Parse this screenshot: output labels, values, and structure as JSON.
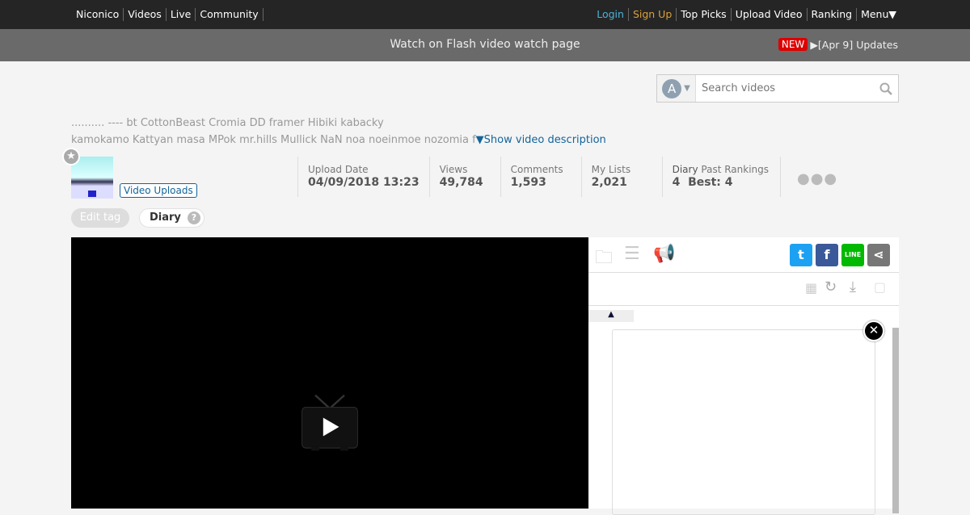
{
  "topbar": {
    "left": [
      "Niconico",
      "Videos",
      "Live",
      "Community"
    ],
    "login": "Login",
    "signup": "Sign Up",
    "right": [
      "Top Picks",
      "Upload Video",
      "Ranking",
      "Menu▼"
    ]
  },
  "subbar": {
    "center": "Watch on Flash video watch page",
    "new_badge": "NEW",
    "news": "▶[Apr 9] Updates"
  },
  "search": {
    "option": "A",
    "placeholder": "Search videos"
  },
  "tags": {
    "line1": ".......... ---- bt CottonBeast Cromia DD framer Hibiki kabacky",
    "line2": "kamokamo Kattyan masa MPok mr.hills Mullick NaN noa noeinmoe nozomia f",
    "show": "▼Show video description"
  },
  "uploader": {
    "uploads": "Video Uploads"
  },
  "stats": [
    {
      "label": "Upload Date",
      "value": "04/09/2018 13:23"
    },
    {
      "label": "Views",
      "value": "49,784"
    },
    {
      "label": "Comments",
      "value": "1,593"
    },
    {
      "label": "My Lists",
      "value": "2,021"
    }
  ],
  "ranking": {
    "label1": "Diary",
    "label2": "Past Rankings",
    "value1": "4",
    "value2": "Best: 4"
  },
  "tagbar": {
    "edit": "Edit tag",
    "tag": "Diary",
    "help": "?"
  },
  "panel": {
    "sort_arrow": "▲",
    "line": "LINE"
  },
  "colors": {
    "twitter": "#1da1f2",
    "facebook": "#3b5998",
    "line": "#00b900",
    "share": "#777777"
  }
}
